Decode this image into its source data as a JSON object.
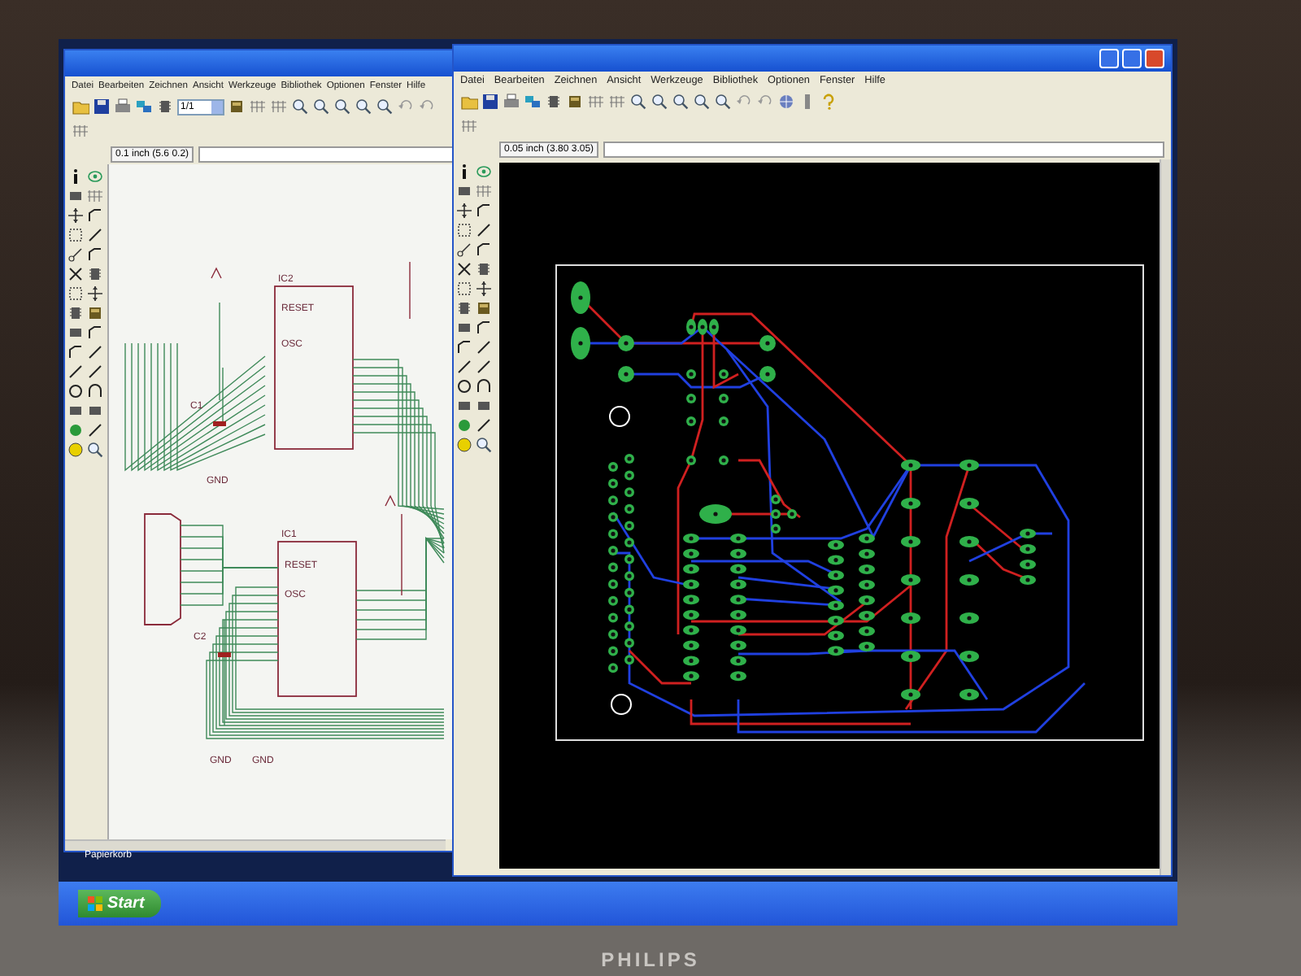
{
  "left_window": {
    "menu": [
      "Datei",
      "Bearbeiten",
      "Zeichnen",
      "Ansicht",
      "Werkzeuge",
      "Bibliothek",
      "Optionen",
      "Fenster",
      "Hilfe"
    ],
    "zoom_combo": "1/1",
    "coordinates": "0.1 inch (5.6 0.2)",
    "schematic": {
      "labels": [
        "IC2",
        "RESET",
        "OSC",
        "C1",
        "GND",
        "IC1",
        "RESET",
        "OSC",
        "C2",
        "GND",
        "GND"
      ]
    }
  },
  "right_window": {
    "menu": [
      "Datei",
      "Bearbeiten",
      "Zeichnen",
      "Ansicht",
      "Werkzeuge",
      "Bibliothek",
      "Optionen",
      "Fenster",
      "Hilfe"
    ],
    "coordinates": "0.05 inch (3.80 3.05)"
  },
  "desktop": {
    "icon_label": "Papierkorb"
  },
  "taskbar": {
    "start_button": "Start"
  },
  "monitor": {
    "brand": "PHILIPS"
  }
}
